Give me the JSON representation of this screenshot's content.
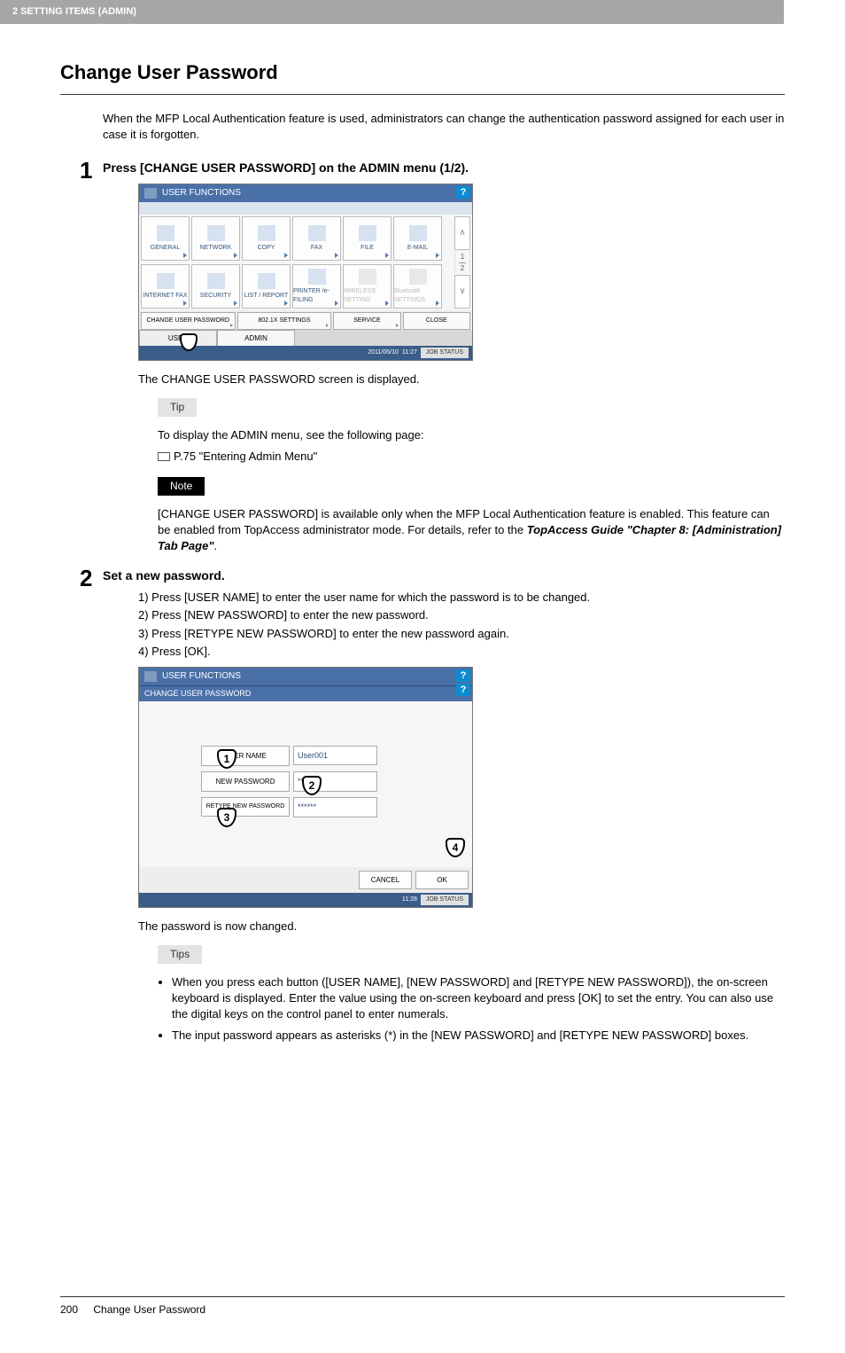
{
  "header": {
    "breadcrumb": "2 SETTING ITEMS (ADMIN)"
  },
  "title": "Change User Password",
  "intro": "When the MFP Local Authentication feature is used, administrators can change the authentication password assigned for each user in case it is forgotten.",
  "step1": {
    "num": "1",
    "title": "Press [CHANGE USER PASSWORD] on the ADMIN menu (1/2).",
    "after_img": "The CHANGE USER PASSWORD screen is displayed."
  },
  "mfp1": {
    "title": "USER FUNCTIONS",
    "help": "?",
    "tiles_row1": [
      "GENERAL",
      "NETWORK",
      "COPY",
      "FAX",
      "FILE",
      "E-MAIL"
    ],
    "tiles_row2": [
      "INTERNET FAX",
      "SECURITY",
      "LIST / REPORT",
      "PRINTER /e-FILING",
      "WIRELESS SETTING",
      "Bluetooth SETTINGS"
    ],
    "page_ind_top": "1",
    "page_ind_bot": "2",
    "bottom_buttons": [
      "CHANGE USER PASSWORD",
      "802.1X SETTINGS",
      "SERVICE",
      "CLOSE"
    ],
    "tabs": [
      "USER",
      "ADMIN"
    ],
    "status_date": "2011/05/10",
    "status_time": "11:27",
    "job_status": "JOB STATUS"
  },
  "tip": {
    "label": "Tip",
    "line1": "To display the ADMIN menu, see the following page:",
    "ref": "P.75 \"Entering Admin Menu\""
  },
  "note": {
    "label": "Note",
    "text_pre": "[CHANGE USER PASSWORD] is available only when the MFP Local Authentication feature is enabled. This feature can be enabled from TopAccess administrator mode. For details, refer to the ",
    "text_em": "TopAccess Guide \"Chapter 8: [Administration] Tab Page\"",
    "text_post": "."
  },
  "step2": {
    "num": "2",
    "title": "Set a new password.",
    "items": [
      "1)  Press [USER NAME] to enter the user name for which the password is to be changed.",
      "2)  Press [NEW PASSWORD] to enter the new password.",
      "3)  Press [RETYPE NEW PASSWORD] to enter the new password again.",
      "4)  Press [OK]."
    ],
    "after_img": "The password is now changed."
  },
  "mfp2": {
    "title": "USER FUNCTIONS",
    "subtitle": "CHANGE USER PASSWORD",
    "help": "?",
    "rows": [
      {
        "label": "USER NAME",
        "value": "User001"
      },
      {
        "label": "NEW PASSWORD",
        "value": "******"
      },
      {
        "label": "RETYPE NEW PASSWORD",
        "value": "******"
      }
    ],
    "callouts": [
      "1",
      "2",
      "3",
      "4"
    ],
    "cancel": "CANCEL",
    "ok": "OK",
    "status_time": "11:28",
    "job_status": "JOB STATUS"
  },
  "tips": {
    "label": "Tips",
    "bullets": [
      "When you press each button ([USER NAME], [NEW PASSWORD] and [RETYPE NEW PASSWORD]), the on-screen keyboard is displayed. Enter the value using the on-screen keyboard and press [OK] to set the entry. You can also use the digital keys on the control panel to enter numerals.",
      "The input password appears as asterisks (*) in the [NEW PASSWORD] and [RETYPE NEW PASSWORD] boxes."
    ]
  },
  "footer": {
    "pagenum": "200",
    "title": "Change User Password"
  }
}
